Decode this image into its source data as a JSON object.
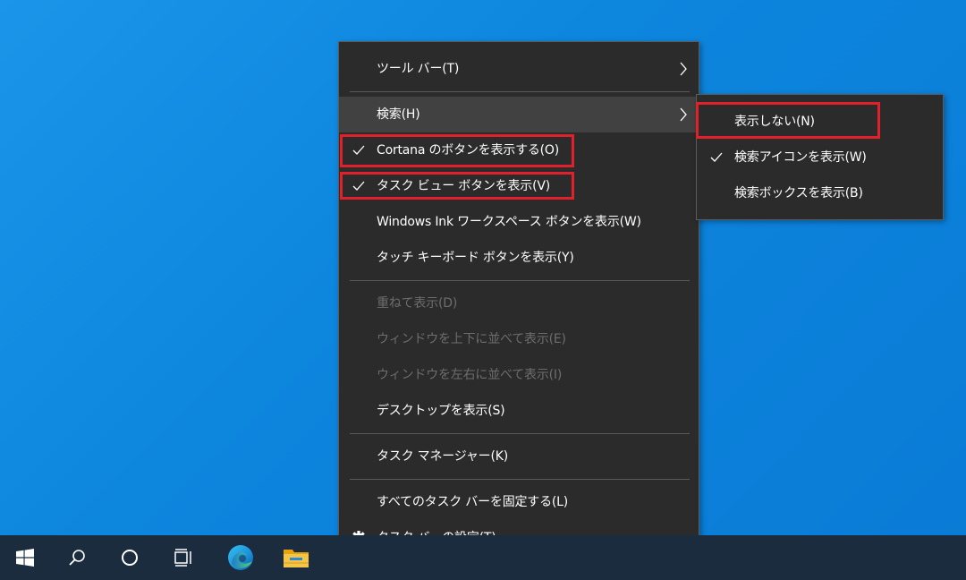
{
  "context_menu": {
    "items": [
      {
        "label": "ツール バー(T)",
        "has_submenu": true
      },
      {
        "label": "検索(H)",
        "has_submenu": true,
        "highlighted": true
      },
      {
        "label": "Cortana のボタンを表示する(O)",
        "checked": true
      },
      {
        "label": "タスク ビュー ボタンを表示(V)",
        "checked": true
      },
      {
        "label": "Windows Ink ワークスペース ボタンを表示(W)"
      },
      {
        "label": "タッチ キーボード ボタンを表示(Y)"
      },
      {
        "label": "重ねて表示(D)",
        "disabled": true
      },
      {
        "label": "ウィンドウを上下に並べて表示(E)",
        "disabled": true
      },
      {
        "label": "ウィンドウを左右に並べて表示(I)",
        "disabled": true
      },
      {
        "label": "デスクトップを表示(S)"
      },
      {
        "label": "タスク マネージャー(K)"
      },
      {
        "label": "すべてのタスク バーを固定する(L)"
      },
      {
        "label": "タスク バーの設定(T)",
        "icon": "gear-icon"
      }
    ]
  },
  "search_submenu": {
    "items": [
      {
        "label": "表示しない(N)"
      },
      {
        "label": "検索アイコンを表示(W)",
        "checked": true
      },
      {
        "label": "検索ボックスを表示(B)"
      }
    ]
  },
  "taskbar": {
    "icons": [
      "windows-start-icon",
      "search-icon",
      "cortana-icon",
      "task-view-icon",
      "edge-icon",
      "file-explorer-icon"
    ]
  },
  "colors": {
    "menu_bg": "#2b2b2b",
    "menu_hover": "#414141",
    "disabled_text": "#6d6d6d",
    "highlight_box": "#e0202a",
    "taskbar_bg": "#1a2c3d",
    "desktop_bg": "#0d86de"
  }
}
